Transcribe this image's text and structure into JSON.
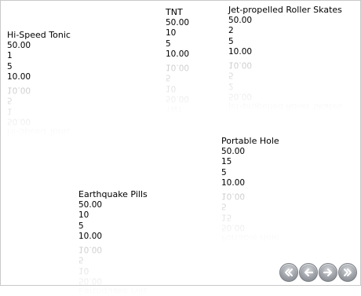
{
  "products": [
    {
      "name": "Hi-Speed Tonic",
      "price": "50.00",
      "qty": "1",
      "units": "5",
      "total": "10.00"
    },
    {
      "name": "TNT",
      "price": "50.00",
      "qty": "10",
      "units": "5",
      "total": "10.00"
    },
    {
      "name": "Jet-propelled Roller Skates",
      "price": "50.00",
      "qty": "2",
      "units": "5",
      "total": "10.00"
    },
    {
      "name": "Portable Hole",
      "price": "50.00",
      "qty": "15",
      "units": "5",
      "total": "10.00"
    },
    {
      "name": "Earthquake Pills",
      "price": "50.00",
      "qty": "10",
      "units": "5",
      "total": "10.00"
    }
  ],
  "nav": {
    "first_icon": "double-chevron-left-icon",
    "prev_icon": "arrow-left-icon",
    "next_icon": "arrow-right-icon",
    "last_icon": "double-chevron-right-icon"
  }
}
